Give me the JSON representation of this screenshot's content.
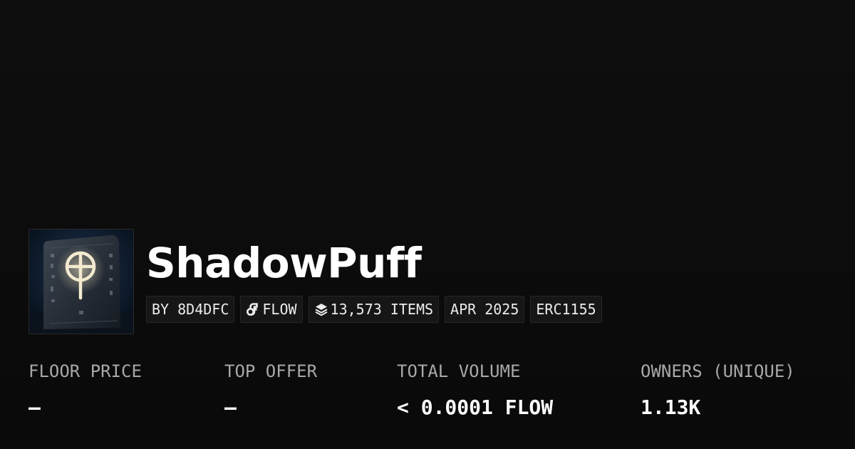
{
  "collection": {
    "title": "ShadowPuff",
    "image_icon": "rune-stone-image"
  },
  "tags": {
    "creator": "BY 8D4DFC",
    "chain": "FLOW",
    "chain_icon": "flow-chain-icon",
    "items": "13,573 ITEMS",
    "items_icon": "layers-icon",
    "date": "APR 2025",
    "standard": "ERC1155"
  },
  "stats": {
    "floor_price_label": "FLOOR PRICE",
    "floor_price_value": "–",
    "top_offer_label": "TOP OFFER",
    "top_offer_value": "–",
    "total_volume_label": "TOTAL VOLUME",
    "total_volume_value": "< 0.0001 FLOW",
    "owners_label": "OWNERS (UNIQUE)",
    "owners_value": "1.13K"
  },
  "colors": {
    "background": "#0c0c0c",
    "tag_background": "#161616",
    "label_gray": "#a8a8a8",
    "text_white": "#ffffff"
  }
}
